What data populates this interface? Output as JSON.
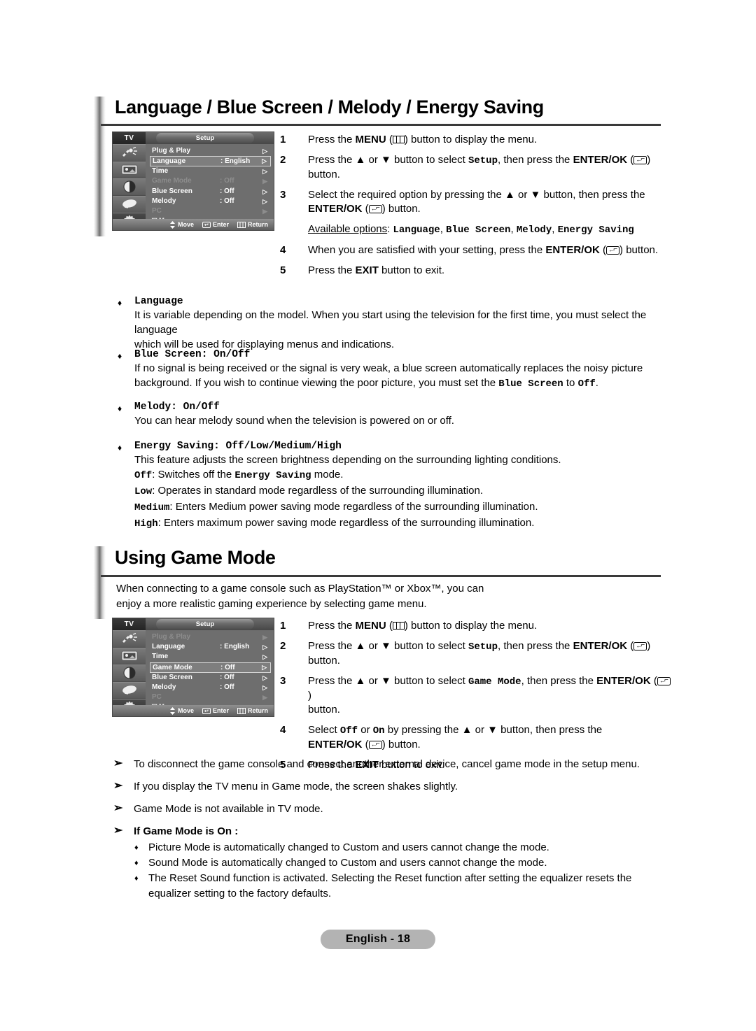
{
  "sections": [
    {
      "title": "Language / Blue Screen / Melody / Energy Saving"
    },
    {
      "title": "Using Game Mode",
      "intro_line1": "When connecting to a game console such as PlayStation™ or Xbox™, you can",
      "intro_line2": "enjoy a more realistic gaming experience by selecting game menu."
    }
  ],
  "osd1": {
    "tv_label": "TV",
    "tab_label": "Setup",
    "rows": [
      {
        "label": "Plug & Play",
        "value": "",
        "arrow": "▷",
        "state": "normal"
      },
      {
        "label": "Language",
        "value": ": English",
        "arrow": "▷",
        "state": "highlight"
      },
      {
        "label": "Time",
        "value": "",
        "arrow": "▷",
        "state": "normal"
      },
      {
        "label": "Game Mode",
        "value": ": Off",
        "arrow": "▶",
        "state": "dim"
      },
      {
        "label": "Blue Screen",
        "value": ": Off",
        "arrow": "▷",
        "state": "normal"
      },
      {
        "label": "Melody",
        "value": ": Off",
        "arrow": "▷",
        "state": "normal"
      },
      {
        "label": "PC",
        "value": "",
        "arrow": "▶",
        "state": "dim"
      }
    ],
    "more": "▽ More",
    "footer": {
      "move": "Move",
      "enter": "Enter",
      "return": "Return"
    },
    "icons": [
      "antenna-input-icon",
      "picture-icon",
      "contrast-icon",
      "sound-icon",
      "setup-gear-icon"
    ]
  },
  "osd2": {
    "tv_label": "TV",
    "tab_label": "Setup",
    "rows": [
      {
        "label": "Plug & Play",
        "value": "",
        "arrow": "▶",
        "state": "dim"
      },
      {
        "label": "Language",
        "value": ": English",
        "arrow": "▷",
        "state": "normal"
      },
      {
        "label": "Time",
        "value": "",
        "arrow": "▷",
        "state": "normal"
      },
      {
        "label": "Game Mode",
        "value": ": Off",
        "arrow": "▷",
        "state": "highlight"
      },
      {
        "label": "Blue Screen",
        "value": ": Off",
        "arrow": "▷",
        "state": "normal"
      },
      {
        "label": "Melody",
        "value": ": Off",
        "arrow": "▷",
        "state": "normal"
      },
      {
        "label": "PC",
        "value": "",
        "arrow": "▶",
        "state": "dim"
      }
    ],
    "more": "▽ More",
    "footer": {
      "move": "Move",
      "enter": "Enter",
      "return": "Return"
    },
    "icons": [
      "antenna-input-icon",
      "picture-icon",
      "contrast-icon",
      "sound-icon",
      "setup-gear-icon"
    ]
  },
  "steps1": {
    "s1_num": "1",
    "s1_a": "Press the ",
    "s1_menu": "MENU",
    "s1_b": " (",
    "s1_c": ") button to display the menu.",
    "s2_num": "2",
    "s2_a": "Press the ▲ or ▼ button to select ",
    "s2_mono": "Setup",
    "s2_b": ", then press the ",
    "s2_enter": "ENTER/OK",
    "s2_c": " (",
    "s2_d": ")",
    "s2_e": "button.",
    "s3_num": "3",
    "s3_a": "Select the required option by pressing the ▲ or ▼ button, then press the",
    "s3_enter": "ENTER/OK",
    "s3_b": " (",
    "s3_c": ") button.",
    "avail_label": "Available options",
    "avail_colon": ": ",
    "avail_opts1": "Language",
    "avail_sep1": ", ",
    "avail_opts2": "Blue Screen",
    "avail_sep2": ", ",
    "avail_opts3": "Melody",
    "avail_sep3": ", ",
    "avail_opts4": "Energy Saving",
    "s4_num": "4",
    "s4_a": "When you are satisfied with your setting, press the ",
    "s4_enter": "ENTER/OK",
    "s4_b": " (",
    "s4_c": ") button.",
    "s5_num": "5",
    "s5_a": "Press the ",
    "s5_exit": "EXIT",
    "s5_b": " button to exit."
  },
  "steps2": {
    "s1_num": "1",
    "s1_a": "Press the ",
    "s1_menu": "MENU",
    "s1_b": " (",
    "s1_c": ") button to display the menu.",
    "s2_num": "2",
    "s2_a": "Press the ▲ or ▼ button to select ",
    "s2_mono": "Setup",
    "s2_b": ", then press the ",
    "s2_enter": "ENTER/OK",
    "s2_c": " (",
    "s2_d": ") button.",
    "s3_num": "3",
    "s3_a": "Press the ▲ or ▼ button to select ",
    "s3_mono": "Game Mode",
    "s3_b": ", then press the ",
    "s3_enter": "ENTER/OK",
    "s3_c": " (",
    "s3_d": ")",
    "s3_e": "button.",
    "s4_num": "4",
    "s4_a": "Select ",
    "s4_off": "Off",
    "s4_mid": " or ",
    "s4_on": "On",
    "s4_b": " by pressing the ▲ or ▼ button, then press the",
    "s4_enter": "ENTER/OK",
    "s4_c": " (",
    "s4_d": ") button.",
    "s5_num": "5",
    "s5_a": "Press the ",
    "s5_exit": "EXIT",
    "s5_b": " button to exit."
  },
  "dblocks": [
    {
      "bullet": "♦",
      "head": "Language",
      "head_suffix": "",
      "body_line1": "It is variable depending on the model. When you start using the television for the first time, you must select the language",
      "body_line2": "which will be used for displaying menus and indications."
    },
    {
      "bullet": "♦",
      "head": "Blue Screen",
      "head_suffix": ": On/Off",
      "body_line1": "If no signal is being received or the signal is very weak, a blue screen automatically replaces the noisy picture",
      "body_line2_a": "background. If you wish to continue viewing the poor picture, you must set the ",
      "body_line2_m1": "Blue Screen",
      "body_line2_b": " to ",
      "body_line2_m2": "Off",
      "body_line2_c": "."
    },
    {
      "bullet": "♦",
      "head": "Melody",
      "head_suffix": ": On/Off",
      "body_line1": "You can hear melody sound when the television is powered on or off."
    },
    {
      "bullet": "♦",
      "head": "Energy Saving",
      "head_suffix": ": Off/Low/Medium/High",
      "body_line1": "This feature adjusts the screen brightness depending on the surrounding lighting conditions.",
      "off_key": "Off",
      "off_a": ": Switches off the ",
      "off_m": "Energy Saving",
      "off_b": " mode.",
      "low_key": "Low",
      "low_a": ": Operates in standard mode regardless of the surrounding illumination.",
      "medium_key": "Medium",
      "medium_a": ": Enters Medium power saving mode regardless of the surrounding illumination.",
      "high_key": "High",
      "high_a": ": Enters maximum power saving mode regardless of the surrounding illumination."
    }
  ],
  "notes": {
    "arrow": "➢",
    "n1": "To disconnect the game console and connect another external device, cancel game mode in the setup menu.",
    "n2": "If you display the TV menu in Game mode, the screen shakes slightly.",
    "n3": "Game Mode is not available in TV mode.",
    "n4_bold": "If Game Mode is On :",
    "sub_bullet": "♦",
    "s1": "Picture Mode is automatically changed to Custom and users cannot change the mode.",
    "s2": "Sound Mode is automatically changed to Custom and users cannot change the mode.",
    "s3_line1": "The Reset Sound function is activated. Selecting the Reset function after setting the equalizer resets the",
    "s3_line2": "equalizer setting to the factory defaults."
  },
  "footer": {
    "label": "English - 18"
  },
  "colors": {
    "osd_bg": "#6e6e6e",
    "osd_highlight": "#7e7e7e",
    "footer_bg": "#b3b3b3",
    "rule": "#3a3a3a"
  }
}
